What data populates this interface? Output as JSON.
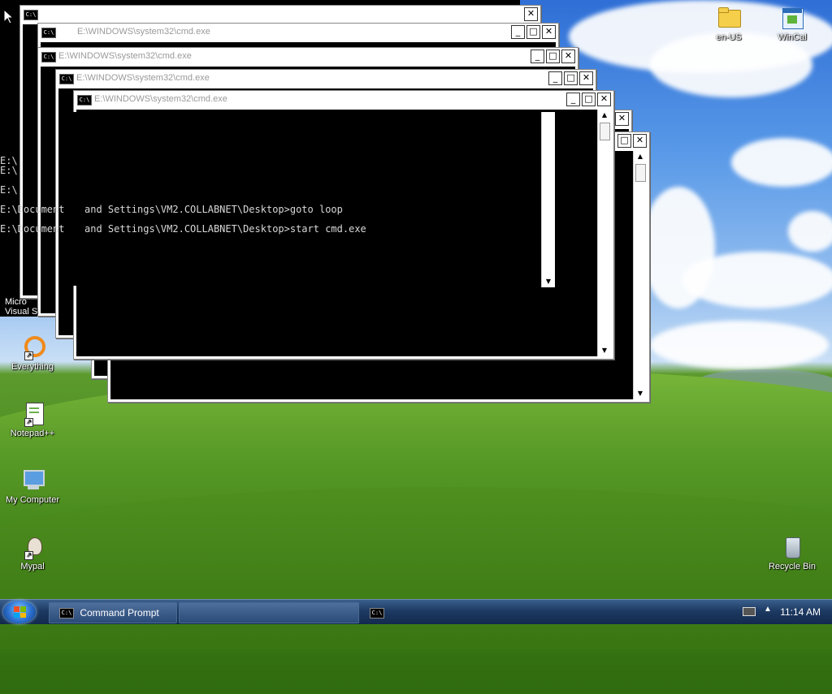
{
  "desktop": {
    "icons": [
      {
        "label": "en-US"
      },
      {
        "label": "WinCal"
      },
      {
        "label": "Micro"
      },
      {
        "label": "Visual S"
      },
      {
        "label": "Everything"
      },
      {
        "label": "Notepad++"
      },
      {
        "label": "My Computer"
      },
      {
        "label": "Mypal"
      },
      {
        "label": "Recycle Bin"
      }
    ]
  },
  "windows": {
    "title": "E:\\WINDOWS\\system32\\cmd.exe",
    "icon_text": "C:\\",
    "minimize": "_",
    "maximize": "□",
    "close": "✕",
    "scroll_up": "▲",
    "scroll_down": "▼"
  },
  "terminal": {
    "lines": [
      "E:\\",
      "E:\\",
      "E:\\",
      "E:\\Document  and Settings\\VM2.COLLABNET\\Desktop>goto loop",
      "E:\\Document  and Settings\\VM2.COLLABNET\\Desktop>start cmd.exe"
    ],
    "front_lines": [
      "and Settings\\VM2.COLLABNET\\Desktop>goto loop",
      "and Settings\\VM2.COLLABNET\\Desktop>start cmd.exe"
    ]
  },
  "taskbar": {
    "task1": "Command Prompt",
    "task_icon": "C:\\",
    "clock": "11:14 AM"
  }
}
